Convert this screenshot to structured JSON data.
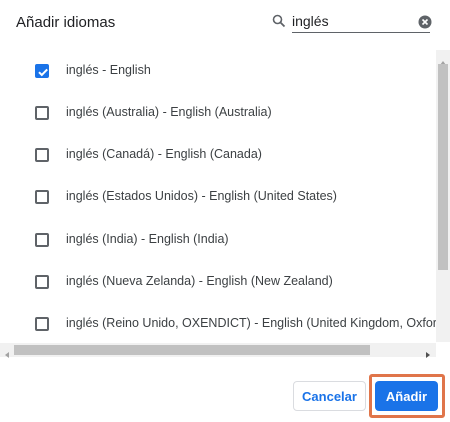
{
  "dialog": {
    "title": "Añadir idiomas",
    "search": {
      "value": "inglés",
      "placeholder": ""
    },
    "languages": [
      {
        "label": "inglés - English",
        "checked": true
      },
      {
        "label": "inglés (Australia) - English (Australia)",
        "checked": false
      },
      {
        "label": "inglés (Canadá) - English (Canada)",
        "checked": false
      },
      {
        "label": "inglés (Estados Unidos) - English (United States)",
        "checked": false
      },
      {
        "label": "inglés (India) - English (India)",
        "checked": false
      },
      {
        "label": "inglés (Nueva Zelanda) - English (New Zealand)",
        "checked": false
      },
      {
        "label": "inglés (Reino Unido, OXENDICT) - English (United Kingdom, Oxford English",
        "checked": false
      }
    ],
    "buttons": {
      "cancel": "Cancelar",
      "add": "Añadir"
    },
    "colors": {
      "accent": "#1a73e8",
      "highlight": "#e0754a"
    }
  }
}
